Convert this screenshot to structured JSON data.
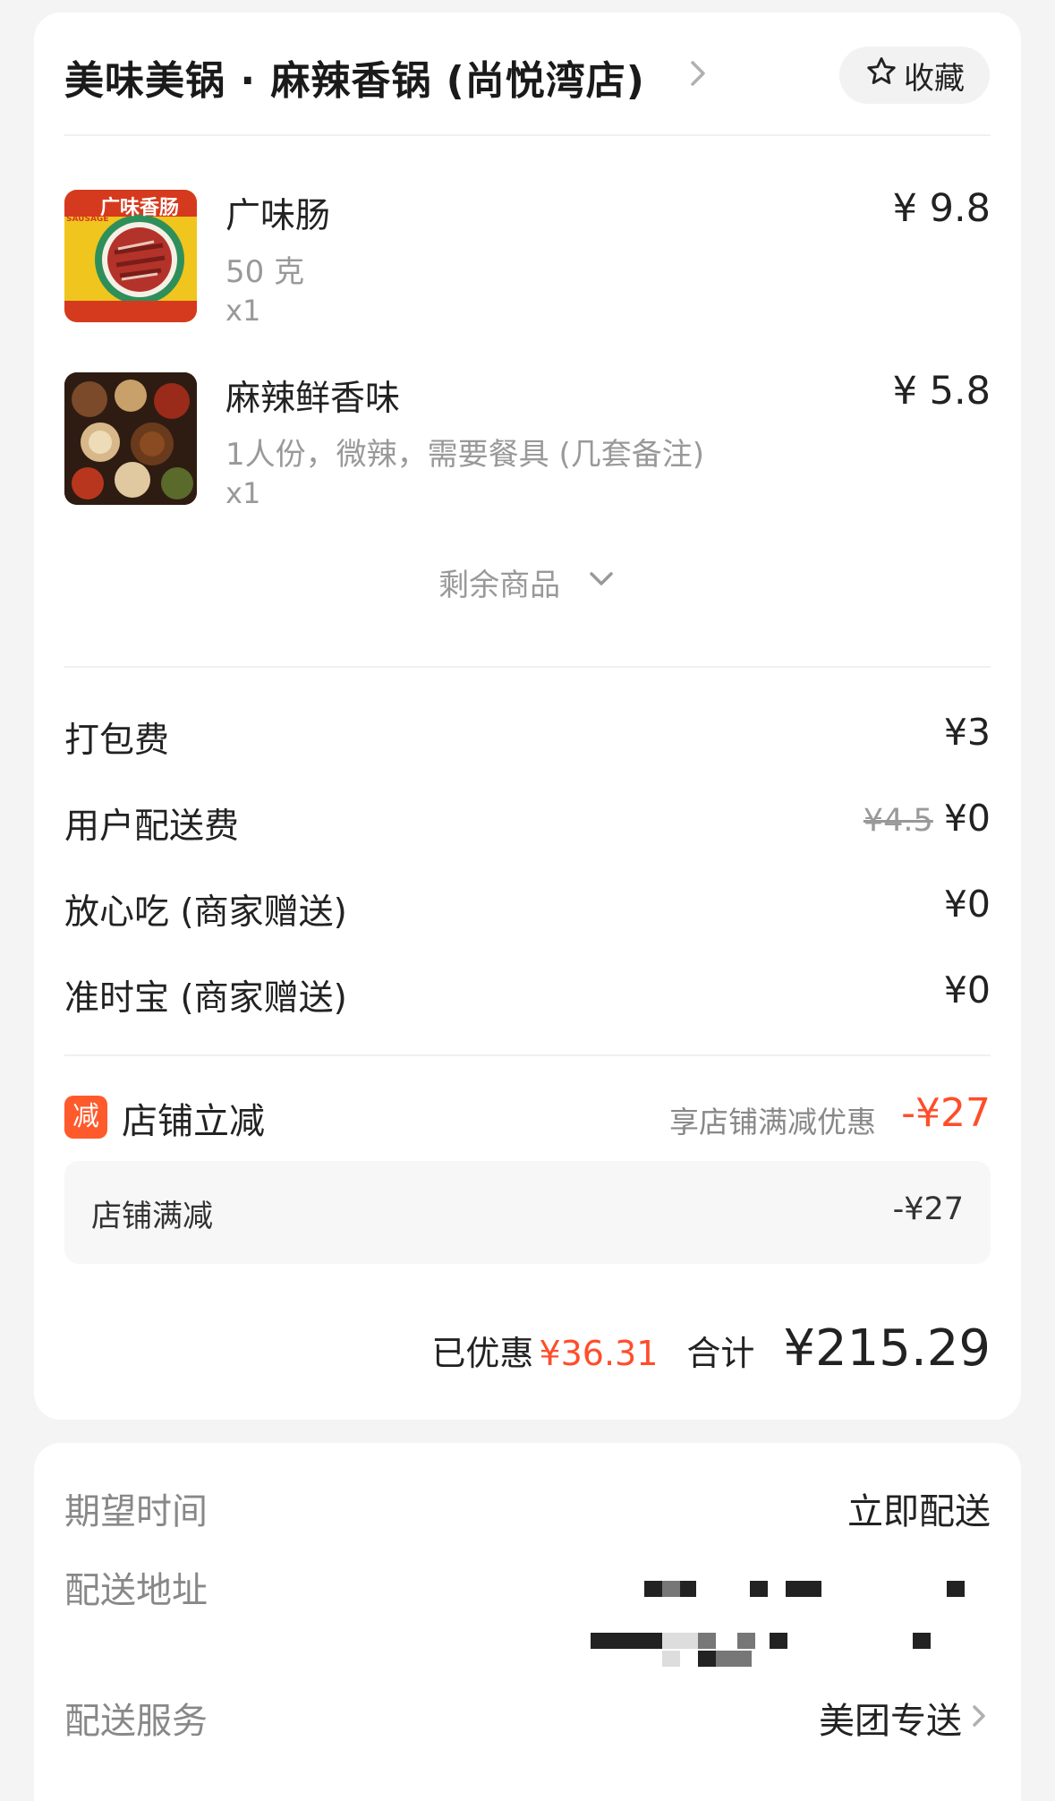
{
  "store": {
    "title": "美味美锅 · 麻辣香锅 (尚悦湾店)",
    "favorite_label": "收藏"
  },
  "items": [
    {
      "name": "广味肠",
      "spec": "50 克",
      "qty": "x1",
      "price": "¥ 9.8",
      "thumb_text": "广味香肠",
      "thumb_side_text": "WIDE FLAVOR SAUSAGE"
    },
    {
      "name": "麻辣鲜香味",
      "spec": "1人份，微辣，需要餐具 (几套备注)",
      "qty": "x1",
      "price": "¥ 5.8"
    }
  ],
  "more_items_label": "剩余商品",
  "fees": [
    {
      "label": "打包费",
      "value": "¥3"
    },
    {
      "label": "用户配送费",
      "original": "¥4.5",
      "value": "¥0"
    },
    {
      "label": "放心吃 (商家赠送)",
      "value": "¥0"
    },
    {
      "label": "准时宝 (商家赠送)",
      "value": "¥0"
    }
  ],
  "promo": {
    "badge": "减",
    "title": "店铺立减",
    "subtitle": "享店铺满减优惠",
    "amount": "-¥27",
    "detail_label": "店铺满减",
    "detail_value": "-¥27",
    "accent_color": "#ff4d2a"
  },
  "summary": {
    "saved_label": "已优惠",
    "saved_value": "¥36.31",
    "total_label": "合计",
    "total_value": "¥215.29"
  },
  "delivery": {
    "time_label": "期望时间",
    "time_value": "立即配送",
    "address_label": "配送地址",
    "service_label": "配送服务",
    "service_value": "美团专送"
  }
}
